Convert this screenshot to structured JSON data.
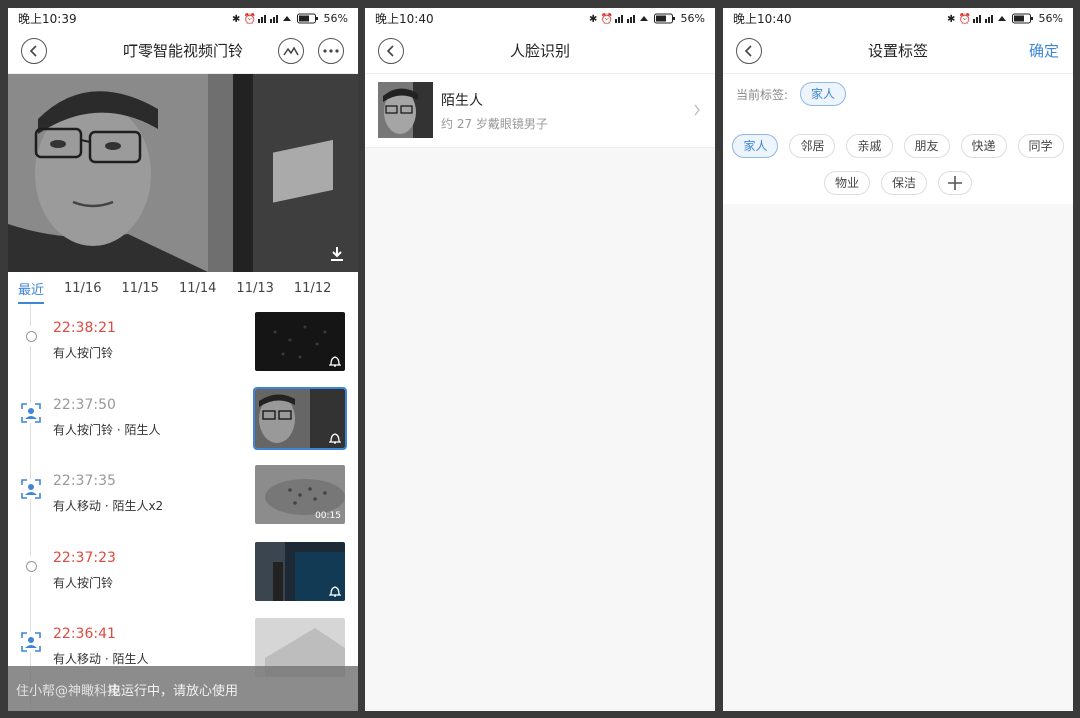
{
  "status_bars": [
    {
      "time": "晚上10:39",
      "battery": "56%"
    },
    {
      "time": "晚上10:40",
      "battery": "56%"
    },
    {
      "time": "晚上10:40",
      "battery": "56%"
    }
  ],
  "panel1": {
    "title": "叮零智能视频门铃",
    "date_tabs": [
      "最近",
      "11/16",
      "11/15",
      "11/14",
      "11/13",
      "11/12"
    ],
    "active_tab": "最近",
    "events": [
      {
        "time": "22:38:21",
        "desc": "有人按门铃",
        "icon": "dot-icon",
        "time_color": "red",
        "thumb_badge": "bell-icon"
      },
      {
        "time": "22:37:50",
        "desc": "有人按门铃 · 陌生人",
        "icon": "face-scan-icon",
        "time_color": "gray",
        "thumb_badge": "bell-icon"
      },
      {
        "time": "22:37:35",
        "desc": "有人移动 · 陌生人x2",
        "icon": "face-scan-icon",
        "time_color": "gray",
        "thumb_badge": "00:15"
      },
      {
        "time": "22:37:23",
        "desc": "有人按门铃",
        "icon": "dot-icon",
        "time_color": "red",
        "thumb_badge": "bell-icon"
      },
      {
        "time": "22:36:41",
        "desc": "有人移动 · 陌生人",
        "icon": "face-scan-icon",
        "time_color": "red",
        "thumb_badge": ""
      }
    ],
    "toast": {
      "watermark": "住小帮@神瞰科技",
      "text": "电运行中，请放心使用"
    }
  },
  "panel2": {
    "title": "人脸识别",
    "face": {
      "name": "陌生人",
      "desc": "约 27 岁戴眼镜男子"
    }
  },
  "panel3": {
    "title": "设置标签",
    "confirm": "确定",
    "current_label": "当前标签:",
    "current_tag": "家人",
    "tags_row1": [
      "家人",
      "邻居",
      "亲戚",
      "朋友",
      "快递",
      "同学"
    ],
    "tags_row2": [
      "物业",
      "保洁"
    ],
    "selected_tag": "家人"
  },
  "colors": {
    "accent": "#3d86d6",
    "alert_red": "#e04a3f"
  }
}
